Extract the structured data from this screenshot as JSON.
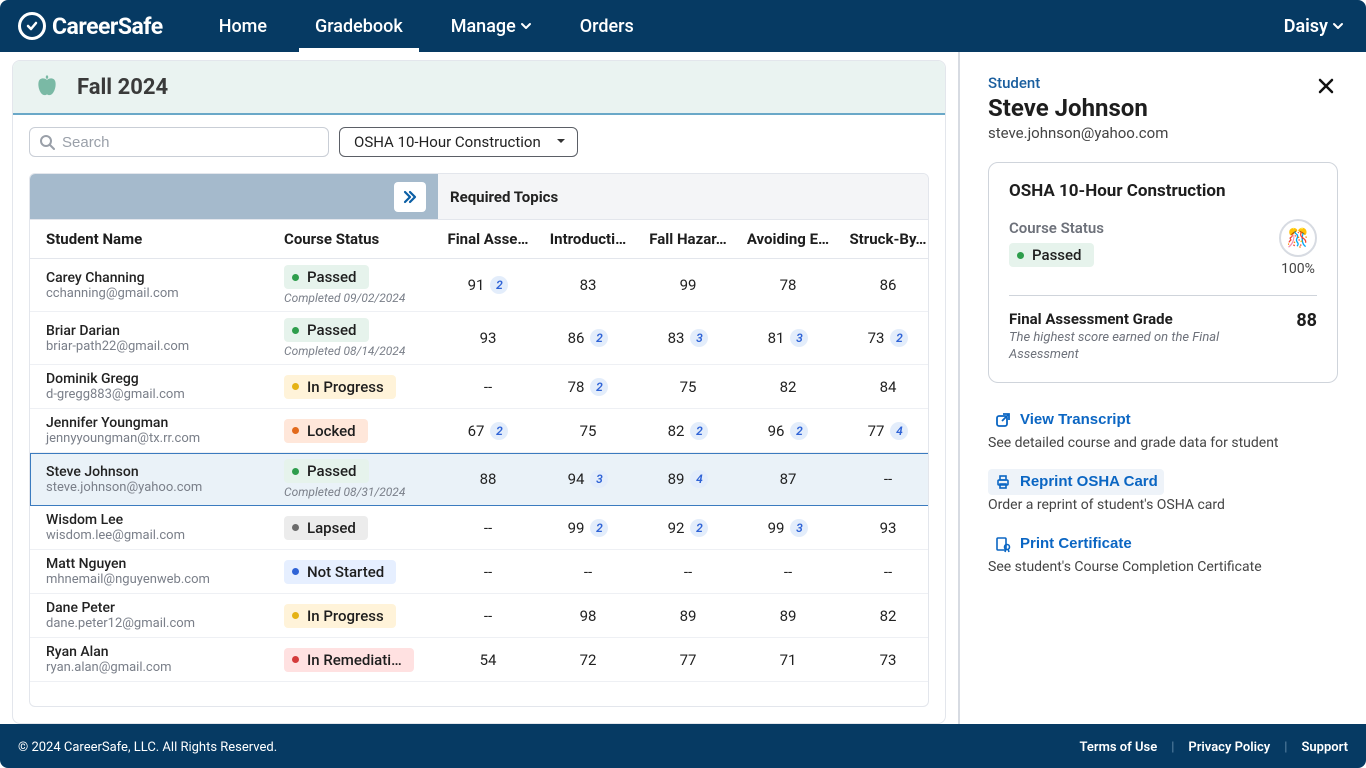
{
  "brand": "CareerSafe",
  "nav": {
    "home": "Home",
    "gradebook": "Gradebook",
    "manage": "Manage",
    "orders": "Orders"
  },
  "user": {
    "name": "Daisy"
  },
  "page": {
    "title": "Fall 2024"
  },
  "search": {
    "placeholder": "Search"
  },
  "course_select": "OSHA 10-Hour Construction",
  "section_header": "Required Topics",
  "columns": {
    "student_name": "Student Name",
    "course_status": "Course Status",
    "final": "Final Asse…",
    "intro": "Introducti…",
    "fall": "Fall Hazar…",
    "avoid": "Avoiding E…",
    "struck": "Struck-By…"
  },
  "statuses": {
    "passed": "Passed",
    "in_progress": "In Progress",
    "locked": "Locked",
    "lapsed": "Lapsed",
    "not_started": "Not Started",
    "in_remediation": "In Remediati…"
  },
  "rows": [
    {
      "name": "Carey Channing",
      "email": "cchanning@gmail.com",
      "status": "passed",
      "completed": "Completed  09/02/2024",
      "final": {
        "v": "91",
        "a": "2"
      },
      "intro": {
        "v": "83"
      },
      "fall": {
        "v": "99"
      },
      "avoid": {
        "v": "78"
      },
      "struck": {
        "v": "86"
      }
    },
    {
      "name": "Briar Darian",
      "email": "briar-path22@gmail.com",
      "status": "passed",
      "completed": "Completed  08/14/2024",
      "final": {
        "v": "93"
      },
      "intro": {
        "v": "86",
        "a": "2"
      },
      "fall": {
        "v": "83",
        "a": "3"
      },
      "avoid": {
        "v": "81",
        "a": "3"
      },
      "struck": {
        "v": "73",
        "a": "2"
      }
    },
    {
      "name": "Dominik Gregg",
      "email": "d-gregg883@gmail.com",
      "status": "in_progress",
      "final": {
        "v": "--"
      },
      "intro": {
        "v": "78",
        "a": "2"
      },
      "fall": {
        "v": "75"
      },
      "avoid": {
        "v": "82"
      },
      "struck": {
        "v": "84"
      }
    },
    {
      "name": "Jennifer Youngman",
      "email": "jennyyoungman@tx.rr.com",
      "status": "locked",
      "final": {
        "v": "67",
        "a": "2"
      },
      "intro": {
        "v": "75"
      },
      "fall": {
        "v": "82",
        "a": "2"
      },
      "avoid": {
        "v": "96",
        "a": "2"
      },
      "struck": {
        "v": "77",
        "a": "4"
      }
    },
    {
      "name": "Steve Johnson",
      "email": "steve.johnson@yahoo.com",
      "status": "passed",
      "completed": "Completed  08/31/2024",
      "selected": true,
      "final": {
        "v": "88"
      },
      "intro": {
        "v": "94",
        "a": "3"
      },
      "fall": {
        "v": "89",
        "a": "4"
      },
      "avoid": {
        "v": "87"
      },
      "struck": {
        "v": "--"
      }
    },
    {
      "name": "Wisdom Lee",
      "email": "wisdom.lee@gmail.com",
      "status": "lapsed",
      "final": {
        "v": "--"
      },
      "intro": {
        "v": "99",
        "a": "2"
      },
      "fall": {
        "v": "92",
        "a": "2"
      },
      "avoid": {
        "v": "99",
        "a": "3"
      },
      "struck": {
        "v": "93"
      }
    },
    {
      "name": "Matt Nguyen",
      "email": "mhnemail@nguyenweb.com",
      "status": "not_started",
      "final": {
        "v": "--"
      },
      "intro": {
        "v": "--"
      },
      "fall": {
        "v": "--"
      },
      "avoid": {
        "v": "--"
      },
      "struck": {
        "v": "--"
      }
    },
    {
      "name": "Dane Peter",
      "email": "dane.peter12@gmail.com",
      "status": "in_progress",
      "final": {
        "v": "--"
      },
      "intro": {
        "v": "98"
      },
      "fall": {
        "v": "89"
      },
      "avoid": {
        "v": "89"
      },
      "struck": {
        "v": "82"
      }
    },
    {
      "name": "Ryan Alan",
      "email": "ryan.alan@gmail.com",
      "status": "in_remediation",
      "final": {
        "v": "54"
      },
      "intro": {
        "v": "72"
      },
      "fall": {
        "v": "77"
      },
      "avoid": {
        "v": "71"
      },
      "struck": {
        "v": "73"
      }
    }
  ],
  "side": {
    "tag": "Student",
    "name": "Steve Johnson",
    "email": "steve.johnson@yahoo.com",
    "card_title": "OSHA 10-Hour Construction",
    "status_label": "Course Status",
    "status": "passed",
    "percent": "100%",
    "celebrate": "🎊",
    "fa_title": "Final Assessment Grade",
    "fa_sub": "The highest score earned on the Final Assessment",
    "fa_score": "88",
    "actions": {
      "transcript": "View Transcript",
      "transcript_desc": "See detailed course and grade data for student",
      "reprint": "Reprint OSHA Card",
      "reprint_desc": "Order a reprint of student's OSHA card",
      "print": "Print Certificate",
      "print_desc": "See student's Course Completion Certificate"
    }
  },
  "footer": {
    "copyright": "© 2024 CareerSafe, LLC. All Rights Reserved.",
    "terms": "Terms of Use",
    "privacy": "Privacy Policy",
    "support": "Support"
  }
}
